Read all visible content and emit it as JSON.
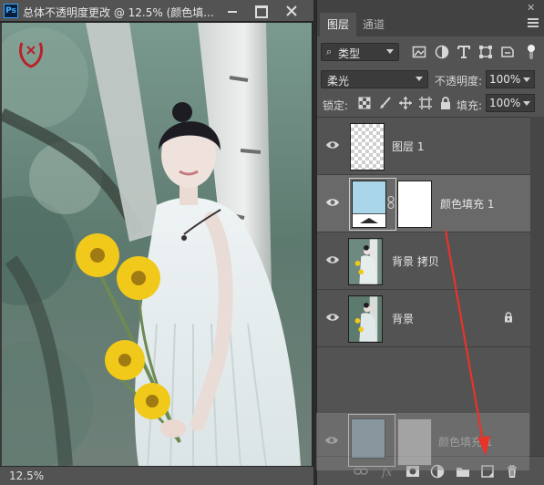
{
  "document": {
    "title": "总体不透明度更改 @ 12.5% (颜色填...",
    "app_logo": "Ps",
    "zoom": "12.5%"
  },
  "panel": {
    "tabs": [
      {
        "label": "图层",
        "active": true
      },
      {
        "label": "通道",
        "active": false
      }
    ],
    "close_glyph": "✕",
    "filter": {
      "label": "类型",
      "icon": "search-icon"
    },
    "blend_mode": "柔光",
    "opacity_label": "不透明度:",
    "opacity_value": "100%",
    "lock_label": "锁定:",
    "fill_label": "填充:",
    "fill_value": "100%",
    "layers": [
      {
        "name": "图层 1",
        "kind": "empty",
        "visible": true,
        "selected": false
      },
      {
        "name": "颜色填充 1",
        "kind": "color-fill",
        "visible": true,
        "selected": true,
        "fill_color": "#a9d6e8"
      },
      {
        "name": "背景 拷贝",
        "kind": "photo",
        "visible": true,
        "selected": false
      },
      {
        "name": "背景",
        "kind": "photo",
        "visible": true,
        "selected": false,
        "locked": true
      }
    ],
    "drag_preview_name": "颜色填充 1"
  },
  "colors": {
    "accent_arrow": "#e8332b",
    "selected_row": "#696969",
    "panel_bg": "#535353"
  }
}
